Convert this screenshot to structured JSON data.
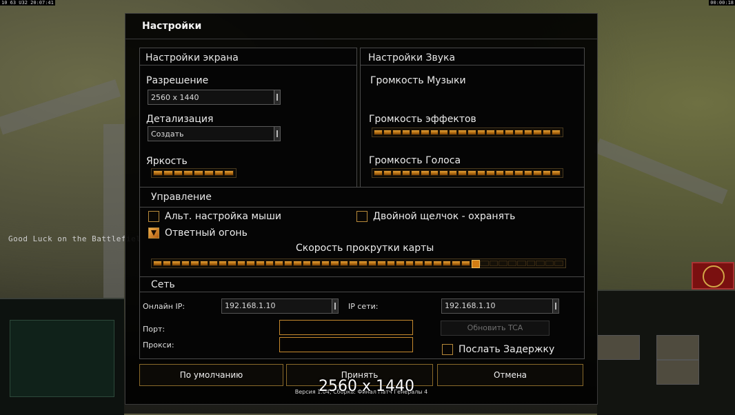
{
  "hud": {
    "top_left": "10 63 U32 20:07:41",
    "top_right": "00:00:18",
    "chat_message": "Good Luck on the Battlefield"
  },
  "dialog": {
    "title": "Настройки",
    "display": {
      "header": "Настройки экрана",
      "resolution_label": "Разрешение",
      "resolution_value": "2560 x 1440",
      "detail_label": "Детализация",
      "detail_value": "Создать",
      "brightness_label": "Яркость",
      "brightness_level": 1.0
    },
    "sound": {
      "header": "Настройки Звука",
      "music_label": "Громкость Музыки",
      "effects_label": "Громкость эффектов",
      "effects_level": 1.0,
      "voice_label": "Громкость Голоса",
      "voice_level": 1.0
    },
    "controls": {
      "header": "Управление",
      "alt_mouse_label": "Альт. настройка мыши",
      "alt_mouse_checked": false,
      "double_click_label": "Двойной щелчок - охранять",
      "double_click_checked": false,
      "return_fire_label": "Ответный огонь",
      "return_fire_checked": true,
      "scroll_speed_label": "Скорость прокрутки карты",
      "scroll_speed_level": 0.79
    },
    "network": {
      "header": "Сеть",
      "online_ip_label": "Онлайн IP:",
      "online_ip_value": "192.168.1.10",
      "lan_ip_label": "IP сети:",
      "lan_ip_value": "192.168.1.10",
      "port_label": "Порт:",
      "port_value": "",
      "proxy_label": "Прокси:",
      "proxy_value": "",
      "update_tca_label": "Обновить TCA",
      "send_delay_label": "Послать Задержку",
      "send_delay_checked": false
    },
    "buttons": {
      "default_label": "По умолчанию",
      "accept_label": "Принять",
      "cancel_label": "Отмена"
    },
    "version": "Версия 1.04, Сборка: Финал Патч Генералы 4"
  },
  "overlay_text": "2560 x 1440",
  "colors": {
    "accent": "#d88a1e",
    "dialog_bg": "#000000",
    "border": "#4a4a4a"
  }
}
